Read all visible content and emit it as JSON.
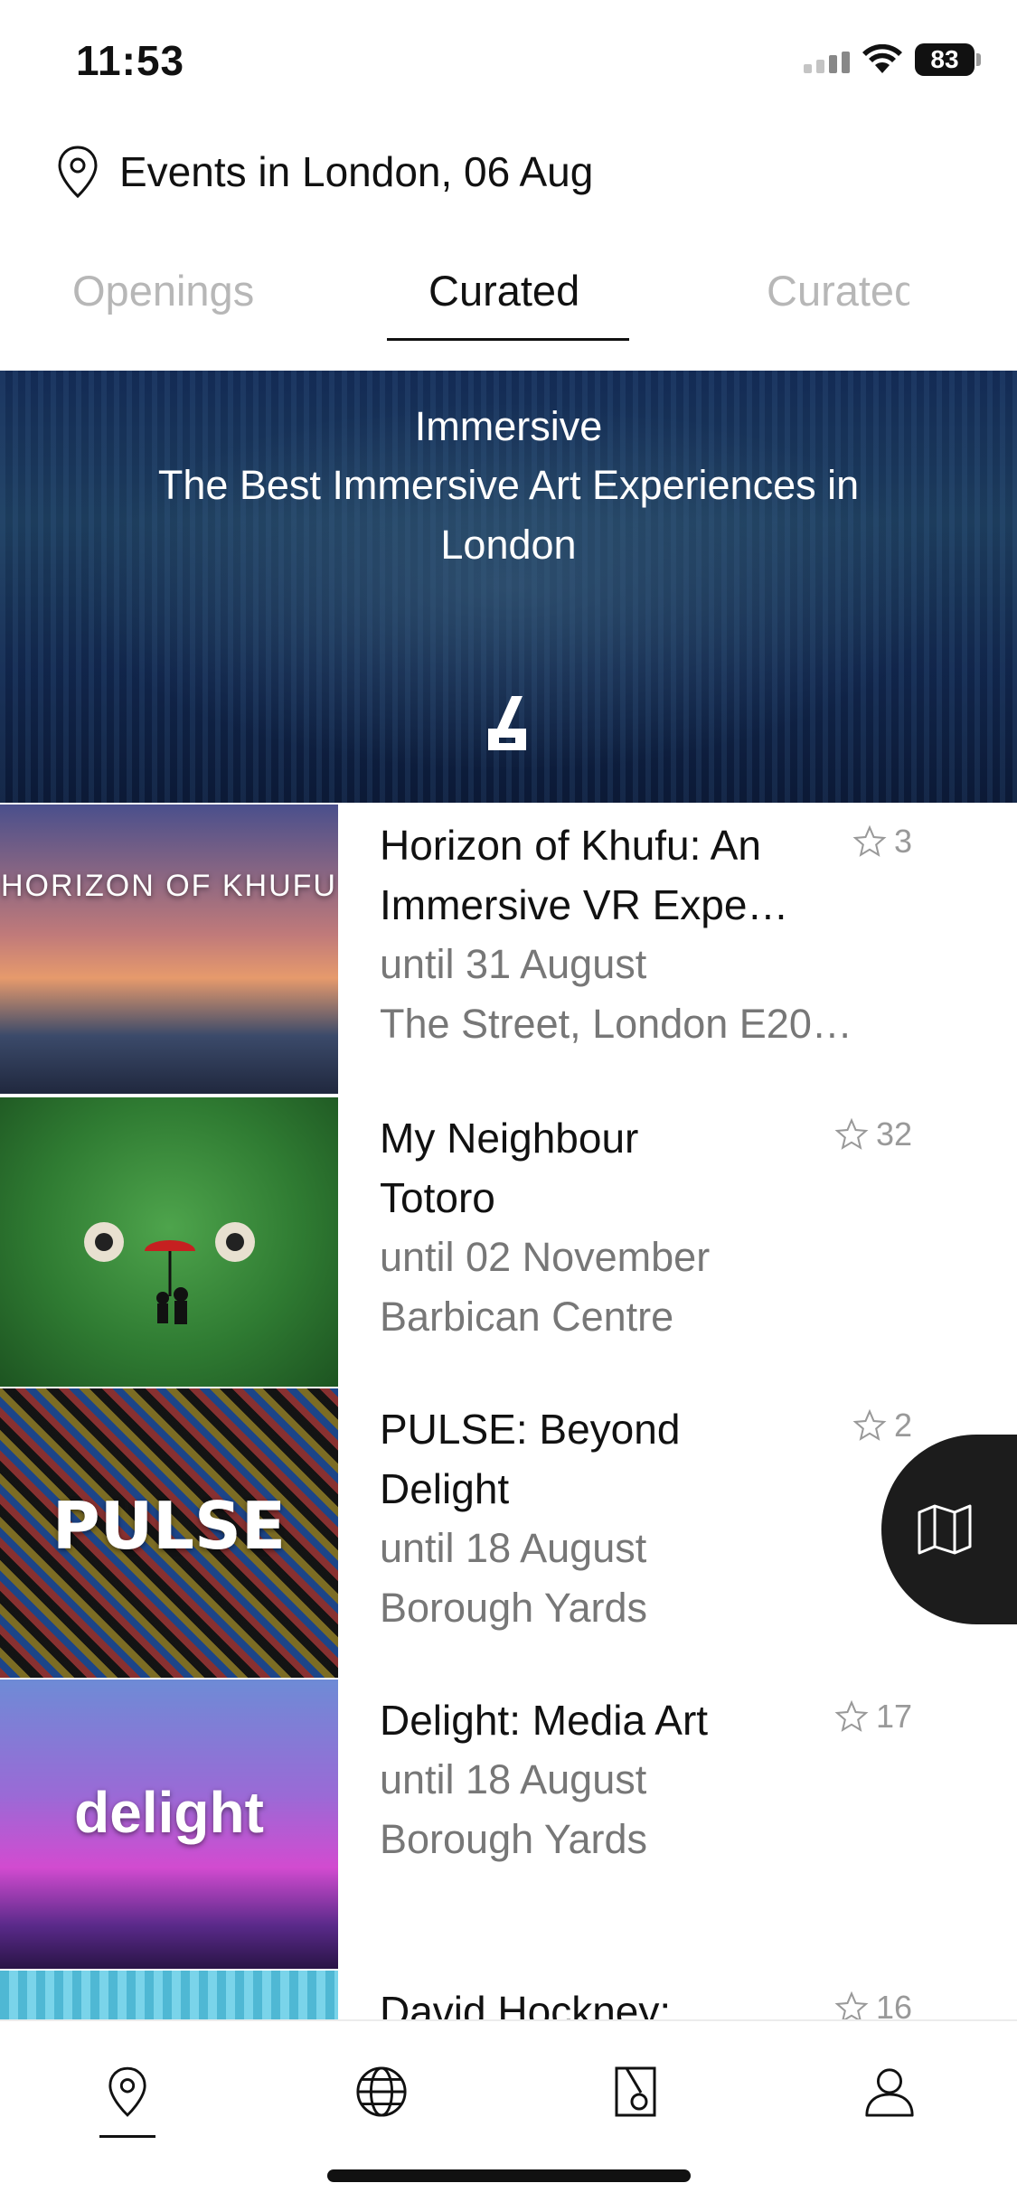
{
  "status_bar": {
    "time": "11:53",
    "battery": "83"
  },
  "header": {
    "title": "Events in London, 06 Aug",
    "icon": "location-pin-icon"
  },
  "tabs": [
    {
      "label": "Openings",
      "active": false
    },
    {
      "label": "Curated",
      "active": true
    },
    {
      "label": "Curated",
      "active": false
    }
  ],
  "hero": {
    "category": "Immersive",
    "title": "The Best Immersive Art Experiences in London",
    "logo_letter": "R"
  },
  "events": [
    {
      "title": "Horizon of Khufu: An Immersive VR Expe…",
      "dates": "until 31 August",
      "venue": "The Street, London E20…",
      "rating": "3",
      "thumb_text": "HORIZON OF KHUFU"
    },
    {
      "title": "My Neighbour Totoro",
      "dates": "until 02 November",
      "venue": "Barbican Centre",
      "rating": "32",
      "thumb_text": ""
    },
    {
      "title": "PULSE: Beyond Delight",
      "dates": "until 18 August",
      "venue": "Borough Yards",
      "rating": "2",
      "thumb_text": "PULSE"
    },
    {
      "title": "Delight: Media Art",
      "dates": "until 18 August",
      "venue": "Borough Yards",
      "rating": "17",
      "thumb_text": "delight"
    },
    {
      "title": "David Hockney:",
      "dates": "",
      "venue": "",
      "rating": "16",
      "thumb_text": ""
    }
  ],
  "map_button": {
    "icon": "map-icon"
  },
  "bottom_nav": [
    {
      "icon": "location-pin-icon",
      "active": true
    },
    {
      "icon": "globe-icon",
      "active": false
    },
    {
      "icon": "r-logo-icon",
      "active": false
    },
    {
      "icon": "profile-icon",
      "active": false
    }
  ],
  "colors": {
    "accent": "#111111",
    "muted": "#777777",
    "tab_inactive": "#b7b7b7"
  }
}
